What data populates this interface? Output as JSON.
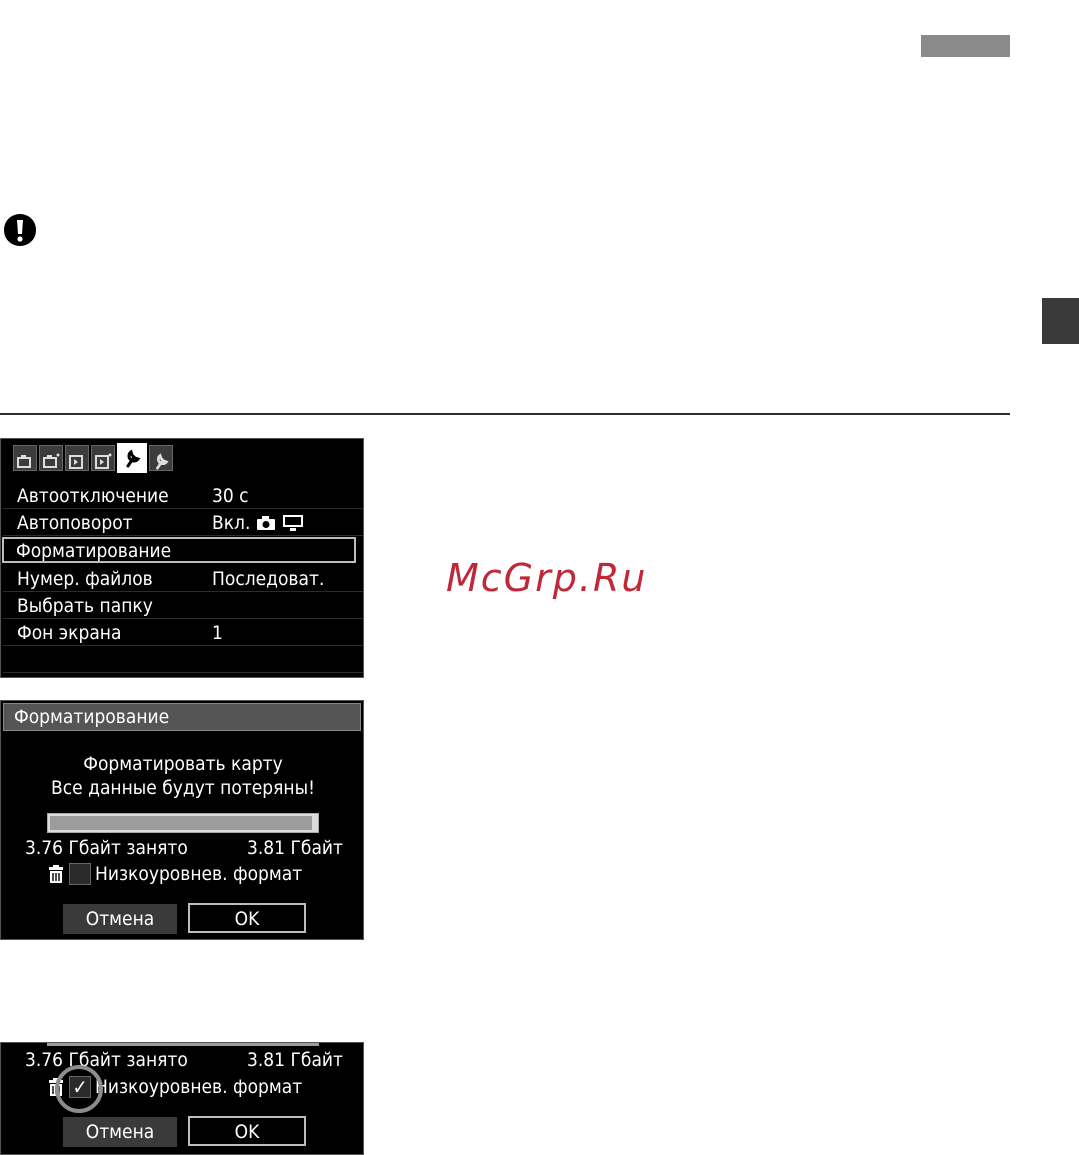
{
  "colors": {
    "page_bg": "#ffffff",
    "lcd_bg": "#000000",
    "watermark": "#c0283a"
  },
  "watermark": "McGrp.Ru",
  "screen1": {
    "active_tab": 4,
    "tabs": [
      "camera-1-icon",
      "camera-2-icon",
      "playback-1-icon",
      "playback-2-icon",
      "setup-1-icon",
      "setup-2-icon"
    ],
    "rows": [
      {
        "label": "Автоотключение",
        "value": "30 с"
      },
      {
        "label": "Автоповорот",
        "value": "Вкл."
      },
      {
        "label": "Форматирование",
        "value": ""
      },
      {
        "label": "Нумер. файлов",
        "value": "Последоват."
      },
      {
        "label": "Выбрать папку",
        "value": ""
      },
      {
        "label": "Фон экрана",
        "value": "1"
      }
    ],
    "selected_row": 2
  },
  "screen2": {
    "title": "Форматирование",
    "line1": "Форматировать карту",
    "line2": "Все данные будут потеряны!",
    "used_fraction": 0.987,
    "used": "3.76 Гбайт занято",
    "total": "3.81 Гбайт",
    "low_level_label": "Низкоуровнев. формат",
    "low_level_checked": false,
    "cancel_label": "Отмена",
    "ok_label": "OK"
  },
  "screen3": {
    "used": "3.76 Гбайт занято",
    "total": "3.81 Гбайт",
    "low_level_label": "Низкоуровнев. формат",
    "low_level_checked": true,
    "check_mark": "✓",
    "cancel_label": "Отмена",
    "ok_label": "OK"
  }
}
